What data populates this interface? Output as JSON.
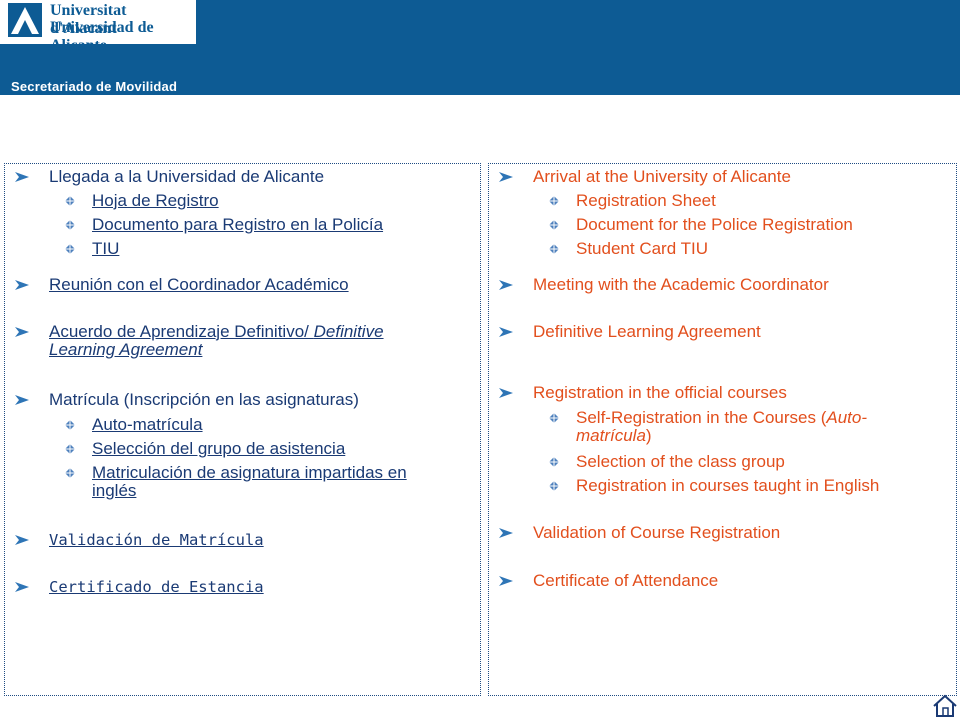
{
  "header": {
    "university_ca": "Universitat d'Alacant",
    "university_es": "Universidad de Alicante",
    "department": "Secretariado  de  Movilidad",
    "brand_color": "#0d5b94"
  },
  "spanish": {
    "arrival": "Llegada a la Universidad de Alicante",
    "registration_sheet": "Hoja de Registro",
    "police_document": "Documento para Registro en la Policía",
    "tiu": "TIU",
    "coordinator_meeting": "Reunión con el Coordinador Académico",
    "learning_agreement": "Acuerdo de Aprendizaje Definitivo/ ",
    "learning_agreement_en": "Definitive",
    "learning_agreement_en2": "Learning Agreement",
    "enrollment": "Matrícula (Inscripción en las asignaturas)",
    "self_enrollment": "Auto-matrícula",
    "group_selection": "Selección del grupo de asistencia",
    "english_courses_1": "Matriculación de asignatura impartidas en",
    "english_courses_2": "inglés",
    "validation": "Validación de Matrícula",
    "certificate": "Certificado de Estancia"
  },
  "english": {
    "arrival": "Arrival at the University of Alicante",
    "registration_sheet": "Registration Sheet",
    "police_document": "Document for the Police Registration",
    "student_card": "Student Card TIU",
    "coordinator_meeting": "Meeting with the Academic Coordinator",
    "learning_agreement": "Definitive Learning Agreement",
    "official_courses": "Registration in the official courses",
    "self_registration_1": "Self-Registration in the Courses (",
    "self_registration_italic": "Auto-",
    "self_registration_2": "matrícula",
    "self_registration_close": ")",
    "class_group": "Selection of the class group",
    "english_courses": "Registration in courses taught in English",
    "validation": "Validation of Course Registration",
    "certificate": "Certificate of Attendance"
  },
  "icons": {
    "arrow": "arrow-bullet-icon",
    "bullet": "diamond-bullet-icon",
    "home": "home-icon"
  }
}
